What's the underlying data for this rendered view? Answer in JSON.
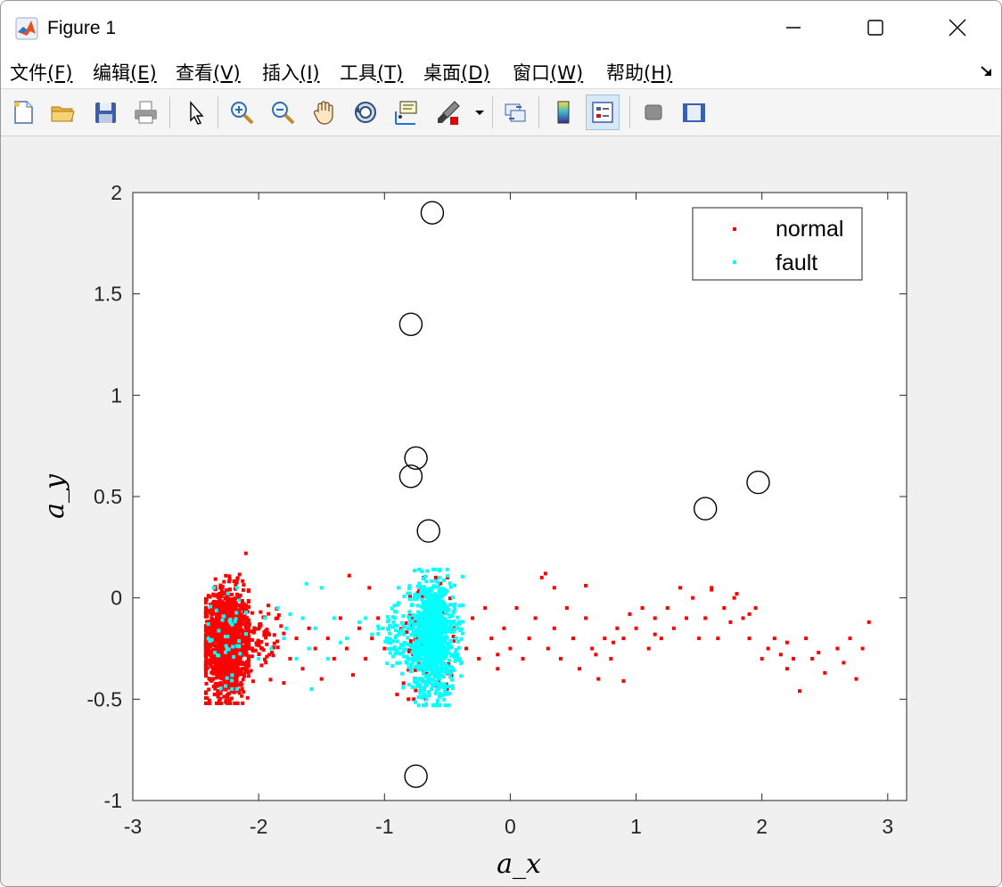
{
  "window": {
    "title": "Figure 1",
    "icons": {
      "app": "matlab-logo-icon",
      "minimize": "minimize-icon",
      "maximize": "maximize-icon",
      "close": "close-icon"
    }
  },
  "menubar": {
    "items": [
      {
        "label": "文件",
        "accel": "(F)"
      },
      {
        "label": "编辑",
        "accel": "(E)"
      },
      {
        "label": "查看",
        "accel": "(V)"
      },
      {
        "label": "插入",
        "accel": "(I)"
      },
      {
        "label": "工具",
        "accel": "(T)"
      },
      {
        "label": "桌面",
        "accel": "(D)"
      },
      {
        "label": "窗口",
        "accel": "(W)"
      },
      {
        "label": "帮助",
        "accel": "(H)"
      }
    ],
    "dock_icon": "dock-arrow-icon"
  },
  "toolbar": {
    "buttons": [
      {
        "icon": "new-figure-icon"
      },
      {
        "icon": "open-file-icon"
      },
      {
        "icon": "save-icon"
      },
      {
        "icon": "print-icon"
      },
      {
        "icon": "select-pointer-icon"
      },
      {
        "icon": "zoom-in-icon"
      },
      {
        "icon": "zoom-out-icon"
      },
      {
        "icon": "pan-hand-icon"
      },
      {
        "icon": "rotate-3d-icon"
      },
      {
        "icon": "data-cursor-icon"
      },
      {
        "icon": "brush-icon"
      },
      {
        "icon": "brush-dropdown-icon"
      },
      {
        "icon": "link-plot-icon"
      },
      {
        "icon": "colorbar-icon"
      },
      {
        "icon": "legend-icon"
      },
      {
        "icon": "hide-plot-tools-icon"
      },
      {
        "icon": "show-plot-tools-icon"
      }
    ],
    "active_icon": "legend-icon"
  },
  "chart_data": {
    "type": "scatter",
    "title": "",
    "xlabel": "a_x",
    "ylabel": "a_y",
    "xlim": [
      -3,
      3.15
    ],
    "ylim": [
      -1,
      2
    ],
    "xticks": [
      "-3",
      "-2",
      "-1",
      "0",
      "1",
      "2",
      "3"
    ],
    "yticks": [
      "-1",
      "-0.5",
      "0",
      "0.5",
      "1",
      "1.5",
      "2"
    ],
    "grid": false,
    "legend": {
      "placement": "top-right",
      "entries": [
        "normal",
        "fault"
      ]
    },
    "colors": {
      "normal": "#ff0000",
      "fault": "#00ffff",
      "circles": "#000000"
    },
    "series": [
      {
        "name": "normal",
        "clusters": [
          {
            "x_center": -2.25,
            "x_spread": 0.09,
            "y_center": -0.22,
            "y_spread": 0.13,
            "count": 1400,
            "x_range": [
              -2.42,
              -2.08
            ],
            "y_range": [
              -0.52,
              0.22
            ]
          },
          {
            "x_center": -2.0,
            "x_spread": 0.1,
            "y_center": -0.2,
            "y_spread": 0.09,
            "count": 90,
            "x_range": [
              -2.1,
              -1.8
            ],
            "y_range": [
              -0.42,
              0.05
            ]
          },
          {
            "x_center": -0.65,
            "x_spread": 0.1,
            "y_center": -0.2,
            "y_spread": 0.15,
            "count": 120,
            "x_range": [
              -0.9,
              -0.45
            ],
            "y_range": [
              -0.5,
              0.1
            ]
          }
        ],
        "sparse_points": [
          [
            -1.85,
            -0.1
          ],
          [
            -1.75,
            -0.3
          ],
          [
            -1.7,
            -0.2
          ],
          [
            -1.65,
            -0.35
          ],
          [
            -1.6,
            -0.15
          ],
          [
            -1.55,
            -0.25
          ],
          [
            -1.5,
            -0.4
          ],
          [
            -1.45,
            -0.2
          ],
          [
            -1.4,
            -0.3
          ],
          [
            -1.35,
            -0.1
          ],
          [
            -1.3,
            -0.25
          ],
          [
            -1.25,
            -0.38
          ],
          [
            -1.2,
            -0.15
          ],
          [
            -1.15,
            -0.3
          ],
          [
            -1.1,
            -0.2
          ],
          [
            -1.05,
            -0.1
          ],
          [
            -1.0,
            -0.25
          ],
          [
            -1.28,
            0.11
          ],
          [
            -1.12,
            0.05
          ],
          [
            -0.35,
            -0.25
          ],
          [
            -0.3,
            -0.1
          ],
          [
            -0.25,
            -0.3
          ],
          [
            -0.2,
            -0.05
          ],
          [
            -0.15,
            -0.2
          ],
          [
            -0.1,
            -0.35
          ],
          [
            -0.05,
            -0.15
          ],
          [
            0.0,
            -0.25
          ],
          [
            0.05,
            -0.05
          ],
          [
            0.1,
            -0.3
          ],
          [
            0.15,
            -0.2
          ],
          [
            0.2,
            -0.1
          ],
          [
            0.25,
            0.1
          ],
          [
            0.3,
            -0.25
          ],
          [
            0.35,
            -0.15
          ],
          [
            0.4,
            -0.3
          ],
          [
            0.45,
            -0.05
          ],
          [
            0.5,
            -0.2
          ],
          [
            0.55,
            -0.35
          ],
          [
            0.6,
            -0.1
          ],
          [
            0.65,
            -0.25
          ],
          [
            0.7,
            -0.4
          ],
          [
            0.75,
            -0.2
          ],
          [
            0.8,
            -0.3
          ],
          [
            0.85,
            -0.15
          ],
          [
            0.9,
            -0.2
          ],
          [
            1.0,
            -0.15
          ],
          [
            1.05,
            -0.05
          ],
          [
            1.1,
            -0.25
          ],
          [
            1.15,
            -0.1
          ],
          [
            1.2,
            -0.2
          ],
          [
            1.25,
            -0.05
          ],
          [
            1.3,
            -0.15
          ],
          [
            1.35,
            0.05
          ],
          [
            1.4,
            -0.1
          ],
          [
            1.45,
            0.0
          ],
          [
            1.5,
            -0.2
          ],
          [
            1.55,
            -0.1
          ],
          [
            1.6,
            0.05
          ],
          [
            1.65,
            -0.2
          ],
          [
            1.7,
            -0.05
          ],
          [
            1.75,
            -0.12
          ],
          [
            1.8,
            0.02
          ],
          [
            1.85,
            -0.1
          ],
          [
            1.9,
            -0.2
          ],
          [
            1.95,
            -0.05
          ],
          [
            2.0,
            -0.3
          ],
          [
            2.05,
            -0.25
          ],
          [
            2.1,
            -0.2
          ],
          [
            2.15,
            -0.28
          ],
          [
            2.2,
            -0.35
          ],
          [
            2.25,
            -0.3
          ],
          [
            2.3,
            -0.46
          ],
          [
            2.35,
            -0.2
          ],
          [
            2.45,
            -0.27
          ],
          [
            2.5,
            -0.37
          ],
          [
            2.6,
            -0.25
          ],
          [
            2.65,
            -0.32
          ],
          [
            2.7,
            -0.2
          ],
          [
            2.75,
            -0.4
          ],
          [
            2.8,
            -0.25
          ],
          [
            2.85,
            -0.12
          ],
          [
            2.2,
            -0.22
          ],
          [
            2.4,
            -0.3
          ],
          [
            1.9,
            -0.08
          ],
          [
            1.78,
            0.0
          ],
          [
            1.6,
            0.04
          ],
          [
            0.9,
            -0.41
          ],
          [
            0.82,
            -0.22
          ],
          [
            0.28,
            0.12
          ],
          [
            0.6,
            0.06
          ],
          [
            0.95,
            -0.08
          ],
          [
            1.15,
            -0.18
          ],
          [
            -0.1,
            -0.28
          ],
          [
            0.68,
            -0.28
          ],
          [
            0.35,
            0.05
          ]
        ]
      },
      {
        "name": "fault",
        "clusters": [
          {
            "x_center": -0.62,
            "x_spread": 0.09,
            "y_center": -0.2,
            "y_spread": 0.14,
            "count": 1100,
            "x_range": [
              -0.85,
              -0.38
            ],
            "y_range": [
              -0.53,
              0.14
            ]
          },
          {
            "x_center": -0.9,
            "x_spread": 0.07,
            "y_center": -0.18,
            "y_spread": 0.09,
            "count": 70,
            "x_range": [
              -1.05,
              -0.8
            ],
            "y_range": [
              -0.4,
              0.05
            ]
          },
          {
            "x_center": -2.25,
            "x_spread": 0.09,
            "y_center": -0.2,
            "y_spread": 0.12,
            "count": 45,
            "x_range": [
              -2.4,
              -2.1
            ],
            "y_range": [
              -0.45,
              0.05
            ]
          }
        ],
        "sparse_points": [
          [
            -1.95,
            -0.1
          ],
          [
            -1.9,
            -0.25
          ],
          [
            -1.85,
            -0.05
          ],
          [
            -1.8,
            -0.2
          ],
          [
            -1.75,
            -0.08
          ],
          [
            -1.7,
            -0.3
          ],
          [
            -1.65,
            -0.1
          ],
          [
            -1.6,
            -0.25
          ],
          [
            -1.55,
            -0.15
          ],
          [
            -1.5,
            0.05
          ],
          [
            -1.45,
            -0.3
          ],
          [
            -1.4,
            -0.1
          ],
          [
            -1.35,
            -0.22
          ],
          [
            -1.3,
            -0.2
          ],
          [
            -1.2,
            -0.12
          ],
          [
            -1.15,
            -0.1
          ],
          [
            -1.1,
            -0.18
          ],
          [
            -1.05,
            -0.14
          ],
          [
            -1.62,
            0.07
          ],
          [
            -2.0,
            -0.3
          ],
          [
            -1.78,
            -0.15
          ],
          [
            -1.58,
            -0.45
          ]
        ]
      },
      {
        "name": "circles",
        "points": [
          [
            -0.62,
            1.9
          ],
          [
            -0.79,
            1.35
          ],
          [
            -0.75,
            0.69
          ],
          [
            -0.79,
            0.6
          ],
          [
            -0.65,
            0.33
          ],
          [
            1.55,
            0.44
          ],
          [
            1.97,
            0.57
          ],
          [
            -0.75,
            -0.88
          ]
        ]
      }
    ]
  }
}
